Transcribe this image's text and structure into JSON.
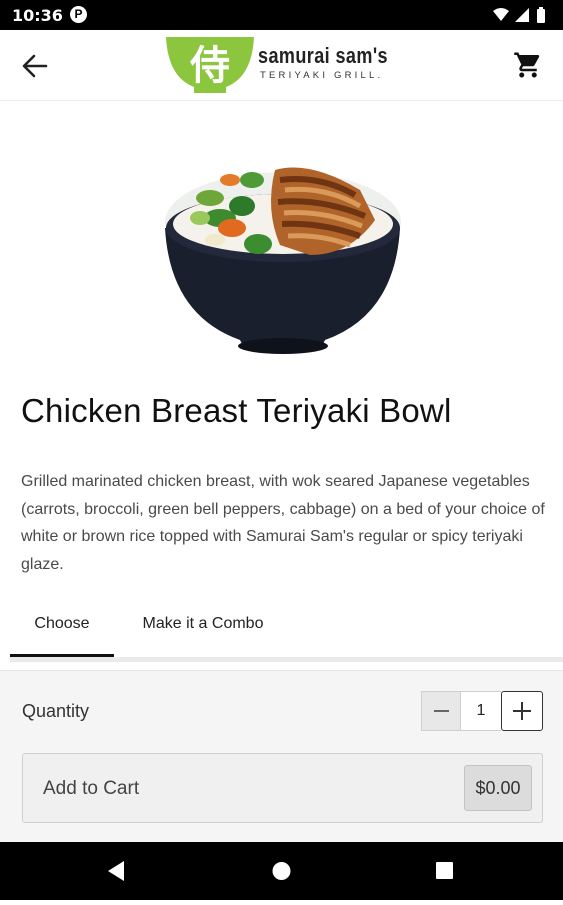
{
  "status_bar": {
    "time": "10:36",
    "notification": "P",
    "icons": [
      "wifi-icon",
      "signal-icon",
      "battery-icon"
    ]
  },
  "app_bar": {
    "back_icon": "arrow-left-icon",
    "cart_icon": "shopping-cart-icon",
    "logo": {
      "mark_glyph": "侍",
      "name": "samurai sam's",
      "tagline": "TERIYAKI GRILL."
    }
  },
  "product": {
    "image": "teriyaki-bowl-photo",
    "title": "Chicken Breast Teriyaki Bowl",
    "description": "Grilled marinated chicken breast, with wok seared Japanese vegetables (carrots, broccoli, green bell peppers, cabbage) on a bed of your choice of white or brown rice topped with Samurai Sam's regular or spicy teriyaki glaze."
  },
  "tabs": [
    {
      "label": "Choose",
      "active": true
    },
    {
      "label": "Make it a Combo",
      "active": false
    }
  ],
  "order": {
    "quantity_label": "Quantity",
    "quantity": "1",
    "add_to_cart_label": "Add to Cart",
    "price": "$0.00"
  },
  "colors": {
    "brand_green": "#8cc63f",
    "status_bar": "#000000",
    "nav_bar": "#000000",
    "panel_bg": "#f5f5f5"
  },
  "nav_bar": {
    "icons": [
      "back-triangle-icon",
      "home-circle-icon",
      "recents-square-icon"
    ]
  }
}
